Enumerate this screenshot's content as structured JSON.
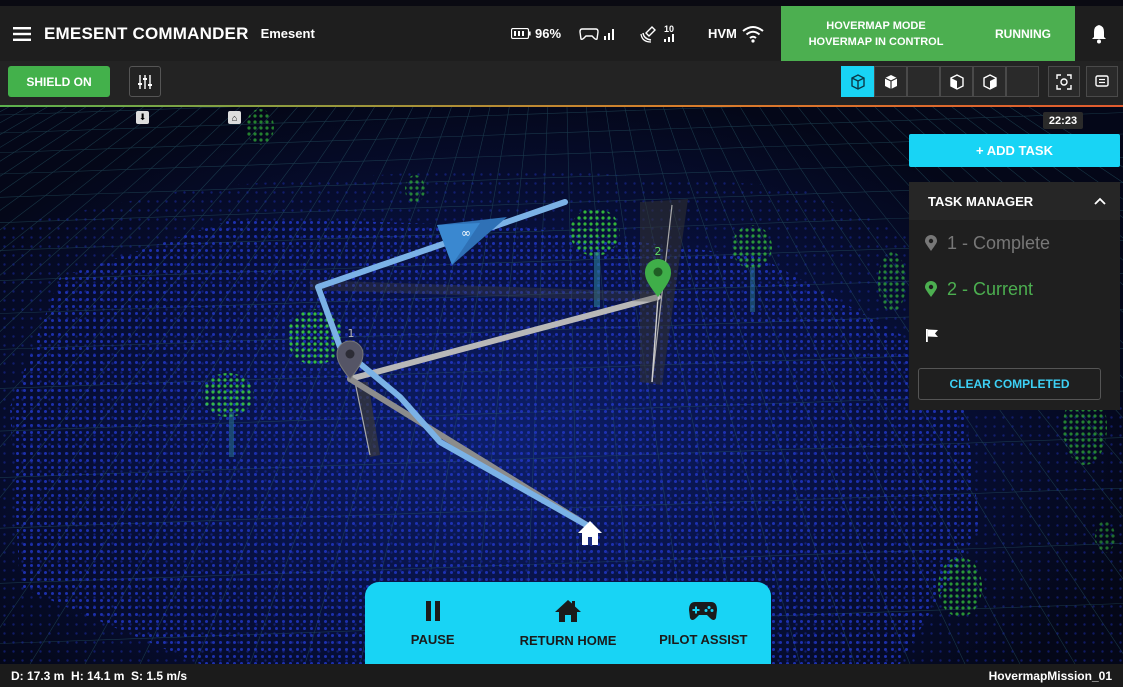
{
  "header": {
    "title": "EMESENT COMMANDER",
    "org": "Emesent",
    "battery": "96%",
    "signal_10": "10",
    "hvm": "HVM",
    "mode_line1": "HOVERMAP MODE",
    "mode_line2": "HOVERMAP IN CONTROL",
    "status": "RUNNING"
  },
  "toolbar": {
    "shield_label": "SHIELD ON",
    "view_icons": [
      "perspective-cube-icon",
      "front-cube-icon",
      "side-cube-icon",
      "top-cube-icon"
    ],
    "extra_icons": [
      "focus-icon",
      "messages-icon"
    ]
  },
  "map": {
    "time": "22:23",
    "waypoint_1": "1",
    "waypoint_2": "2"
  },
  "tasks": {
    "add_label": "+ ADD TASK",
    "manager_title": "TASK MANAGER",
    "items": [
      {
        "label": "1 - Complete",
        "state": "complete"
      },
      {
        "label": "2 - Current",
        "state": "current"
      }
    ],
    "clear_label": "CLEAR COMPLETED"
  },
  "actions": {
    "pause": "PAUSE",
    "return_home": "RETURN HOME",
    "pilot_assist": "PILOT ASSIST"
  },
  "status_bar": {
    "telemetry": "D: 17.3 m  H: 14.1 m  S: 1.5 m/s",
    "mission": "HovermapMission_01"
  },
  "colors": {
    "accent": "#18d4f5",
    "green": "#4caf50",
    "bar": "#1e1e1e"
  }
}
